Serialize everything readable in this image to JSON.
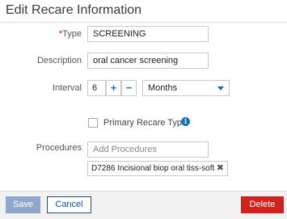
{
  "dialog": {
    "title": "Edit Recare Information"
  },
  "form": {
    "type": {
      "required_mark": "*",
      "label": "Type",
      "value": "SCREENING"
    },
    "description": {
      "label": "Description",
      "value": "oral cancer screening"
    },
    "interval": {
      "label": "Interval",
      "value": "6",
      "plus_glyph": "+",
      "minus_glyph": "−",
      "unit_selected": "Months"
    },
    "primary_recare": {
      "label": "Primary Recare Type",
      "checked": false,
      "info_glyph": "i"
    },
    "procedures": {
      "label": "Procedures",
      "placeholder": "Add Procedures",
      "selected": [
        {
          "text": "D7286  Incisional biop oral tiss-soft",
          "remove_glyph": "✖"
        }
      ]
    }
  },
  "footer": {
    "save_label": "Save",
    "cancel_label": "Cancel",
    "delete_label": "Delete"
  },
  "colors": {
    "accent": "#1a73b5",
    "save_bg": "#8fa9cd",
    "delete_bg": "#d0231d",
    "required": "#d0021b"
  }
}
